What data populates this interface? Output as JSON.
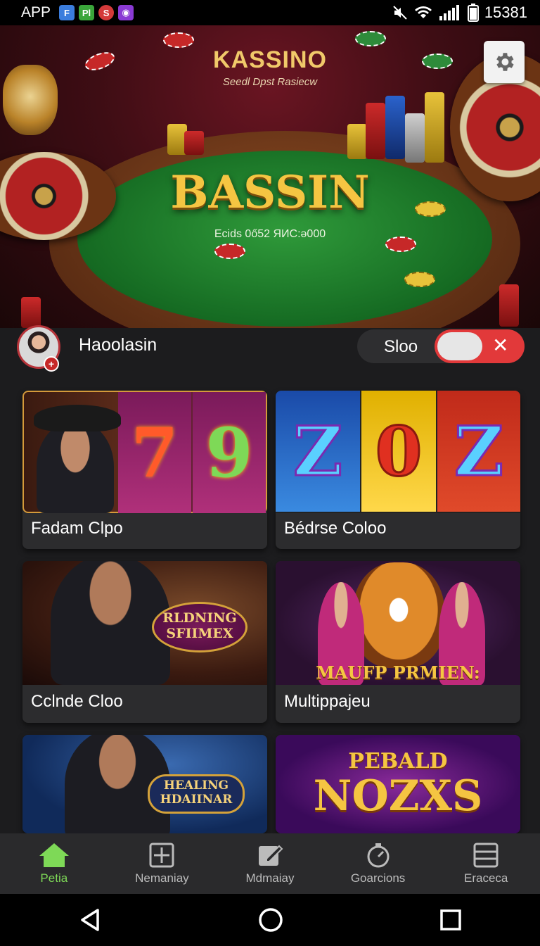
{
  "status_bar": {
    "app_label": "APP",
    "time": "15381",
    "icons": [
      "app-blue-icon",
      "app-green-icon",
      "app-red-icon",
      "app-purple-icon",
      "mute-icon",
      "wifi-icon",
      "signal-icon",
      "battery-icon"
    ]
  },
  "hero": {
    "brand": "KASSINO",
    "subtitle": "Seedl Dpst Rasiecw",
    "title": "BASSIN",
    "code": "Ecids 0ő52 ЯИС:ǝ000"
  },
  "user": {
    "name": "Haoolasin",
    "toggle_label": "Sloo",
    "toggle_state": "off"
  },
  "games": [
    {
      "label": "Fadam Clpo",
      "art": "slot-777"
    },
    {
      "label": "Bédrse Coloo",
      "art": "slot-z0z",
      "reels": [
        "Z",
        "0",
        "Z"
      ]
    },
    {
      "label": "Cclnde Cloo",
      "art": "host-banner",
      "banner": "RLDNING SFIIMEX"
    },
    {
      "label": "Multippajeu",
      "art": "tiger-banner",
      "banner": "MAUFP PRMIEN:"
    },
    {
      "label": "",
      "art": "host-banner-2",
      "banner": "HEALING HDAIINAR"
    },
    {
      "label": "",
      "art": "neon-banner",
      "banner_top": "PEBALD",
      "banner_main": "NOZXS"
    }
  ],
  "nav": [
    {
      "label": "Petia",
      "icon": "home-icon",
      "active": true
    },
    {
      "label": "Nemaniay",
      "icon": "grid-plus-icon",
      "active": false
    },
    {
      "label": "Mdmaiay",
      "icon": "edit-icon",
      "active": false
    },
    {
      "label": "Goarcions",
      "icon": "timer-icon",
      "active": false
    },
    {
      "label": "Eraceca",
      "icon": "list-icon",
      "active": false
    }
  ],
  "colors": {
    "accent_green": "#7ed957",
    "toggle_red": "#e2393a",
    "felt_green": "#1f7e2c",
    "gold": "#f5c542"
  }
}
